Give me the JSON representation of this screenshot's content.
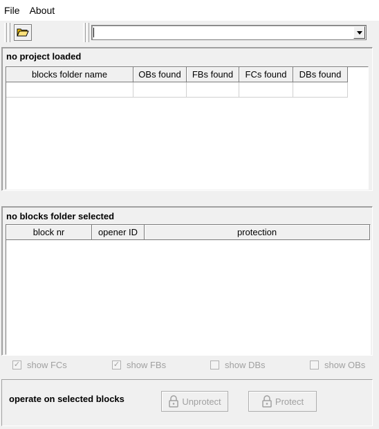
{
  "menu": {
    "items": [
      "File",
      "About"
    ]
  },
  "toolbar": {
    "open_icon": "folder-open-icon",
    "project_path": "",
    "dropdown_icon": "chevron-down-icon"
  },
  "project_panel": {
    "title": "no project loaded",
    "columns": [
      "blocks folder name",
      "OBs found",
      "FBs found",
      "FCs found",
      "DBs found"
    ],
    "rows": [
      [
        "",
        "",
        "",
        "",
        ""
      ]
    ]
  },
  "blocks_panel": {
    "title": "no blocks folder selected",
    "columns": [
      "block nr",
      "opener ID",
      "protection"
    ],
    "rows": []
  },
  "filters": [
    {
      "label": "show FCs",
      "checked": true
    },
    {
      "label": "show FBs",
      "checked": true
    },
    {
      "label": "show DBs",
      "checked": false
    },
    {
      "label": "show OBs",
      "checked": false
    }
  ],
  "operations": {
    "label": "operate on selected blocks",
    "unprotect_label": "Unprotect",
    "protect_label": "Protect",
    "lock_icon": "lock-icon"
  },
  "colors": {
    "disabled_text": "#a0a0a0",
    "folder_icon": "#f5c400"
  }
}
